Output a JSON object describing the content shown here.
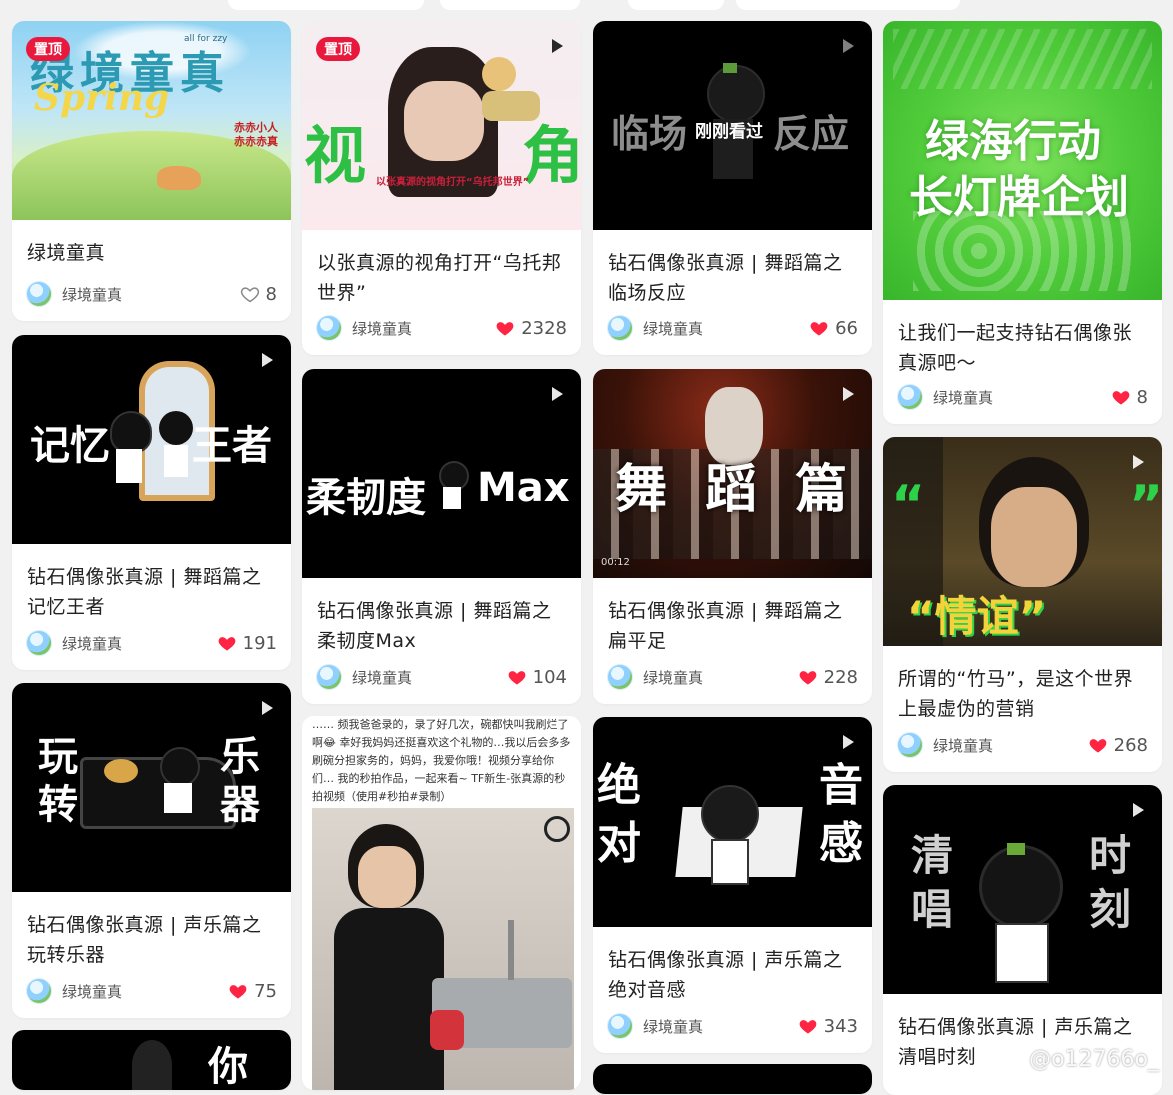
{
  "feed": {
    "cards": [
      {
        "title": "绿境童真",
        "cover_text": "绿境童真",
        "cover_sub": "Spring",
        "cover_tag": "all for zzy",
        "cover_badge_1": "赤赤小人",
        "cover_badge_2": "赤赤赤真",
        "pinned": "置顶",
        "author": "绿境童真",
        "likes": "8",
        "liked": false
      },
      {
        "title": "以张真源的视角打开“乌托邦世界”",
        "cover_left": "视",
        "cover_right": "角",
        "cover_caption": "以张真源的视角打开“乌托邦世界”",
        "pinned": "置顶",
        "author": "绿境童真",
        "likes": "2328",
        "liked": true
      },
      {
        "title": "钻石偶像张真源 | 舞蹈篇之临场反应",
        "cover_left": "临场",
        "cover_right": "反应",
        "overlay": "刚刚看过",
        "author": "绿境童真",
        "likes": "66",
        "liked": true
      },
      {
        "title": "让我们一起支持钻石偶像张真源吧～",
        "cover_line1": "绿海行动",
        "cover_line2": "长灯牌企划",
        "author": "绿境童真",
        "likes": "8",
        "liked": true
      },
      {
        "title": "钻石偶像张真源 | 舞蹈篇之记忆王者",
        "cover_left": "记忆",
        "cover_right": "王者",
        "author": "绿境童真",
        "likes": "191",
        "liked": true
      },
      {
        "title": "钻石偶像张真源 | 舞蹈篇之柔韧度Max",
        "cover_left": "柔韧度",
        "cover_right": "Max",
        "author": "绿境童真",
        "likes": "104",
        "liked": true
      },
      {
        "title": "钻石偶像张真源 | 舞蹈篇之扁平足",
        "cover_text": "舞 蹈 篇",
        "time": "00:12",
        "author": "绿境童真",
        "likes": "228",
        "liked": true
      },
      {
        "title": "所谓的“竹马”，是这个世界上最虚伪的营销",
        "cover_text": "“情谊”",
        "author": "绿境童真",
        "likes": "268",
        "liked": true
      },
      {
        "title": "钻石偶像张真源 | 声乐篇之玩转乐器",
        "cover_left": "玩转",
        "cover_right": "乐器",
        "author": "绿境童真",
        "likes": "75",
        "liked": true
      },
      {
        "cover_text": "…… 频我爸爸录的，录了好几次，碗都快叫我刷烂了啊😂 幸好我妈妈还挺喜欢这个礼物的…我以后会多多刷碗分担家务的，妈妈，我爱你哦！视频分享给你们… 我的秒拍作品，一起来看~ TF新生-张真源的秒拍视频（使用#秒拍#录制）"
      },
      {
        "title": "钻石偶像张真源 | 声乐篇之绝对音感",
        "cover_left": "绝对",
        "cover_right": "音感",
        "author": "绿境童真",
        "likes": "343",
        "liked": true
      },
      {
        "title": "钻石偶像张真源 | 声乐篇之清唱时刻",
        "cover_left": "清唱",
        "cover_right": "时刻"
      },
      {
        "cover_text": "你"
      }
    ],
    "watermark": "@o12766o_",
    "colors": {
      "like": "#ff2442",
      "accent": "#e8193c"
    }
  }
}
